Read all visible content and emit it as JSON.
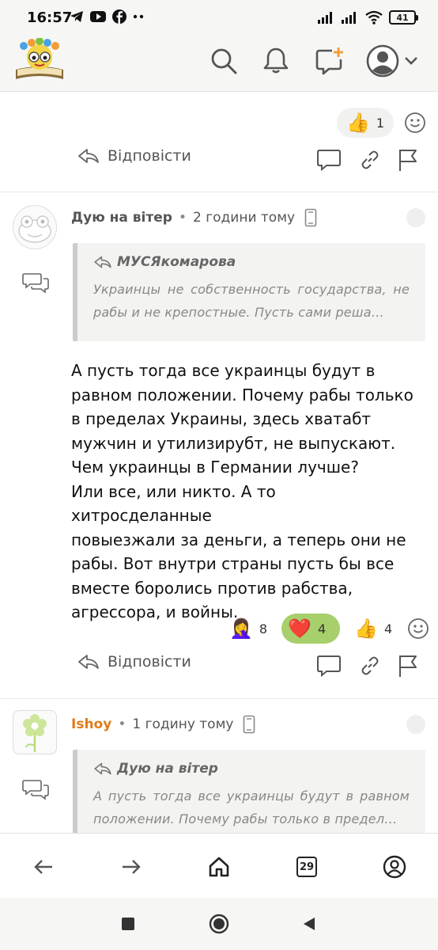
{
  "status_bar": {
    "time": "16:57",
    "battery": "41",
    "left_icons": [
      "telegram-icon",
      "youtube-icon",
      "facebook-icon",
      "more-dots-icon"
    ],
    "right_icons": [
      "signal-icon",
      "signal-icon",
      "wifi-icon",
      "battery-icon"
    ]
  },
  "header": {
    "icons": [
      "search-icon",
      "bell-icon",
      "new-post-icon",
      "user-avatar-icon",
      "chevron-down-icon"
    ]
  },
  "top_comment": {
    "reactions": [
      {
        "emoji": "👍",
        "count": "1",
        "active": false
      }
    ],
    "reply_label": "Відповісти"
  },
  "comment1": {
    "author": "Дую на вітер",
    "time": "2 години тому",
    "quote_author": "МУСЯкомарова",
    "quote_text": "Украинцы не собственность государства, не рабы и не крепостные. Пусть сами реша…",
    "body_lines": [
      "А пусть тогда все украинцы будут в",
      "равном положении. Почему рабы только",
      "в пределах Украины, здесь хватабт",
      "мужчин и утилизирубт, не выпускают.",
      "Чем украинцы в Германии лучше?",
      "Или все, или никто. А то хитросделанные",
      "повыезжали за деньги, а теперь они не",
      "рабы. Вот внутри страны пусть бы все",
      "вместе боролись против рабства,",
      "агрессора, и войны."
    ],
    "reactions": [
      {
        "emoji": "🤦‍♀️",
        "count": "8",
        "active": false
      },
      {
        "emoji": "❤️",
        "count": "4",
        "active": true
      },
      {
        "emoji": "👍",
        "count": "4",
        "active": false
      }
    ],
    "reply_label": "Відповісти"
  },
  "comment2": {
    "author": "Ishoy",
    "time": "1 годину тому",
    "quote_author": "Дую на вітер",
    "quote_text": "А пусть тогда все украинцы будут в равном положении. Почему рабы только в предел…"
  },
  "browser_nav": {
    "tabs_count": "29"
  },
  "colors": {
    "accent_green": "#a7cf6b",
    "author_orange": "#e07b1a"
  }
}
